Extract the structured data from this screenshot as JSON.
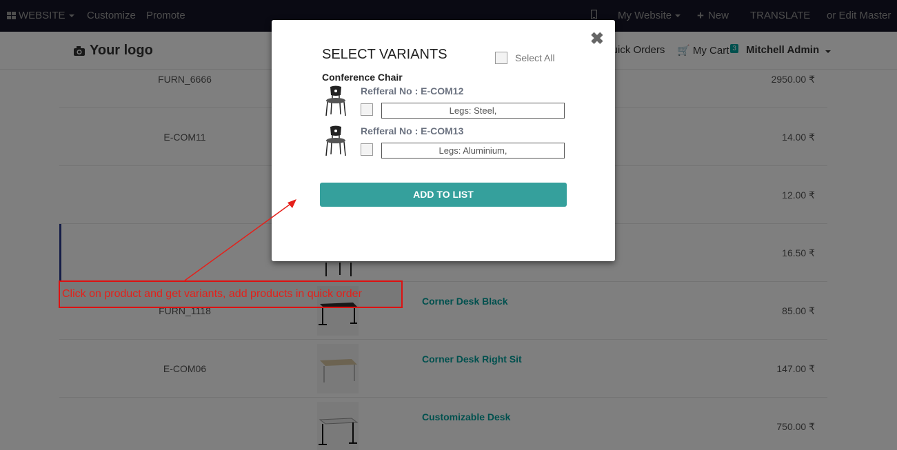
{
  "topbar": {
    "website_label": "WEBSITE",
    "customize_label": "Customize",
    "promote_label": "Promote",
    "my_website_label": "My Website",
    "new_label": "New",
    "translate_label": "TRANSLATE",
    "edit_master_label": "or Edit Master"
  },
  "header": {
    "logo_text": "Your logo",
    "quick_orders_label": "Quick Orders",
    "cart_label": "My Cart",
    "cart_count": "3",
    "user_label": "Mitchell Admin"
  },
  "products": [
    {
      "ref": "FURN_6666",
      "name": "",
      "price": "2950.00 ₹"
    },
    {
      "ref": "E-COM11",
      "name": "",
      "price": "14.00 ₹"
    },
    {
      "ref": "",
      "name": "",
      "price": "12.00 ₹"
    },
    {
      "ref": "",
      "name": "",
      "price": "16.50 ₹"
    },
    {
      "ref": "FURN_1118",
      "name": "Corner Desk Black",
      "price": "85.00 ₹"
    },
    {
      "ref": "E-COM06",
      "name": "Corner Desk Right Sit",
      "price": "147.00 ₹"
    },
    {
      "ref": "",
      "name": "Customizable Desk",
      "price": "750.00 ₹"
    }
  ],
  "modal": {
    "title": "SELECT VARIANTS",
    "select_all_label": "Select All",
    "product_name": "Conference Chair",
    "variants": [
      {
        "ref": "Refferal No : E-COM12",
        "attribute": "Legs: Steel,"
      },
      {
        "ref": "Refferal No : E-COM13",
        "attribute": "Legs: Aluminium,"
      }
    ],
    "add_button_label": "ADD TO LIST",
    "close_symbol": "✖"
  },
  "annotation": {
    "text": "Click on product and get variants, add products in quick order"
  },
  "colors": {
    "accent": "#00a09d",
    "button": "#35a09c",
    "annotation": "#e5201a",
    "topbar": "#141426"
  }
}
